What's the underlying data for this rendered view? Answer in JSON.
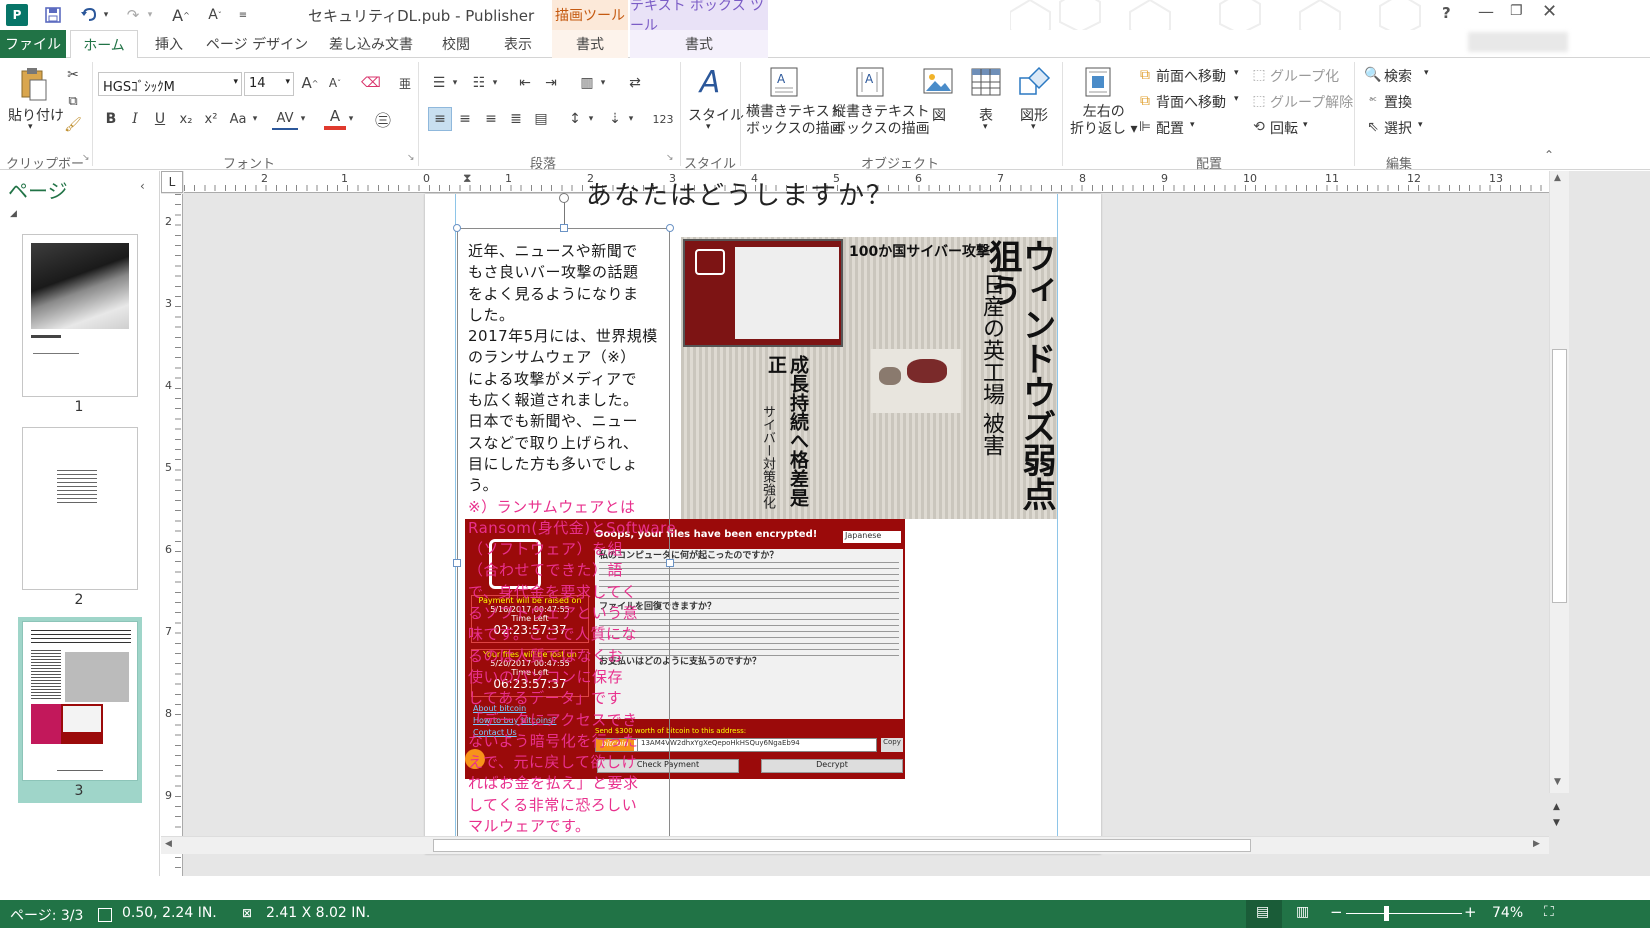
{
  "app": {
    "window_title": "セキュリティDL.pub - Publisher",
    "help": "?",
    "context_tools": {
      "drawing": "描画ツール",
      "textbox": "テキスト ボックス ツール"
    }
  },
  "tabs": {
    "file": "ファイル",
    "home": "ホーム",
    "insert": "挿入",
    "page_design": "ページ デザイン",
    "mailings": "差し込み文書",
    "review": "校閲",
    "view": "表示",
    "format1": "書式",
    "format2": "書式"
  },
  "ribbon": {
    "clipboard": {
      "paste": "貼り付け",
      "label": "クリップボード"
    },
    "font": {
      "name": "HGSｺﾞｼｯｸM",
      "size": "14",
      "bold": "B",
      "italic": "I",
      "underline": "U",
      "subscript": "x₂",
      "superscript": "x²",
      "case": "Aa",
      "spacing": "AV",
      "color": "A",
      "grow": "A",
      "shrink": "A",
      "label": "フォント"
    },
    "paragraph": {
      "label": "段落",
      "number_format": "123"
    },
    "styles": {
      "btn": "スタイル",
      "label": "スタイル"
    },
    "objects": {
      "h_textbox_l1": "横書きテキスト",
      "h_textbox_l2": "ボックスの描画",
      "v_textbox_l1": "縦書きテキスト",
      "v_textbox_l2": "ボックスの描画",
      "picture": "図",
      "table": "表",
      "shapes": "図形",
      "label": "オブジェクト"
    },
    "arrange": {
      "wrap_l1": "左右の",
      "wrap_l2": "折り返し",
      "bring_forward": "前面へ移動",
      "send_backward": "背面へ移動",
      "align": "配置",
      "group": "グループ化",
      "ungroup": "グループ解除",
      "rotate": "回転",
      "label": "配置"
    },
    "editing": {
      "find": "検索",
      "replace": "置換",
      "select": "選択",
      "label": "編集"
    }
  },
  "pages_pane": {
    "title": "ページ",
    "pages": [
      "1",
      "2",
      "3"
    ]
  },
  "ruler": {
    "corner": "L",
    "h_numbers": [
      "2",
      "1",
      "0",
      "1",
      "2",
      "3",
      "4",
      "5",
      "6",
      "7",
      "8",
      "9",
      "10",
      "11",
      "12",
      "13"
    ],
    "v_numbers": [
      "2",
      "3",
      "4",
      "5",
      "6",
      "7",
      "8",
      "9"
    ]
  },
  "document": {
    "heading": "あなたはどうしますか？",
    "body_lines": [
      "近年、ニュースや新聞で",
      "もさ良いバー攻撃の話題",
      "をよく見るようになりま",
      "した。",
      "2017年5月には、世界規模",
      "のランサムウェア（※）",
      "による攻撃がメディアで",
      "も広く報道されました。",
      "日本でも新聞や、ニュー",
      "スなどで取り上げられ、",
      "目にした方も多いでしょ",
      "う。"
    ],
    "note_lines": [
      "※）ランサムウェアとは",
      "Ransom(身代金)とSoftware",
      "（ソフトウェア）を組",
      "（合わせてできた）語",
      "で、身代金を要求してく",
      "るソフトウェアという意",
      "味です。ここで人質にな",
      "るのは人質ではなくお",
      "使いのパソコンに保存",
      "してあるデータ」です",
      "「データにアクセスでき",
      "ないよう暗号化を行った",
      "えで、元に戻して欲しけ",
      "ればお金を払え」と要求",
      "してくる非常に恐ろしい",
      "マルウェアです。"
    ],
    "newspaper": {
      "headline_main": "ウィンドウズ弱点狙う",
      "headline_sub": "日産の英工場 被害",
      "headline_top": "100か国サイバー攻撃",
      "headline_side": "成長持続へ格差是正",
      "side_small": "サイバー対策強化"
    },
    "ransom_window": {
      "title": "Ooops, your files have been encrypted!",
      "language": "Japanese",
      "q1": "私のコンピュータに何が起こったのですか？",
      "q2": "ファイルを回復できますか？",
      "q3": "お支払いはどのように支払うのですか？",
      "payment_raised": "Payment will be raised on",
      "payment_date": "5/16/2017 00:47:55",
      "time_left": "Time Left",
      "timer1": "02:23:57:37",
      "files_lost": "Your files will be lost on",
      "lost_date": "5/20/2017 00:47:55",
      "timer2": "06:23:57:37",
      "about_bitcoin": "About bitcoin",
      "how_to_buy": "How to buy bitcoins?",
      "contact_us": "Contact Us",
      "send": "Send $300 worth of bitcoin to this address:",
      "address": "13AM4VW2dhxYgXeQepoHkHSQuy6NgaEb94",
      "copy": "Copy",
      "check_payment": "Check Payment",
      "decrypt": "Decrypt",
      "bitcoin": "bitcoin",
      "accepted": "ACCEPTED HERE"
    }
  },
  "status": {
    "page": "ページ: 3/3",
    "position": "0.50, 2.24 IN.",
    "size": "2.41 X  8.02 IN.",
    "zoom": "74%",
    "zoom_minus": "−",
    "zoom_plus": "+"
  },
  "colors": {
    "accent": "#217346",
    "publisher_teal": "#077568",
    "drawing_tools": "#f37725",
    "textbox_tools": "#7b5cc6",
    "pink_text": "#e8308d",
    "ransom_red": "#9b0a0a"
  }
}
